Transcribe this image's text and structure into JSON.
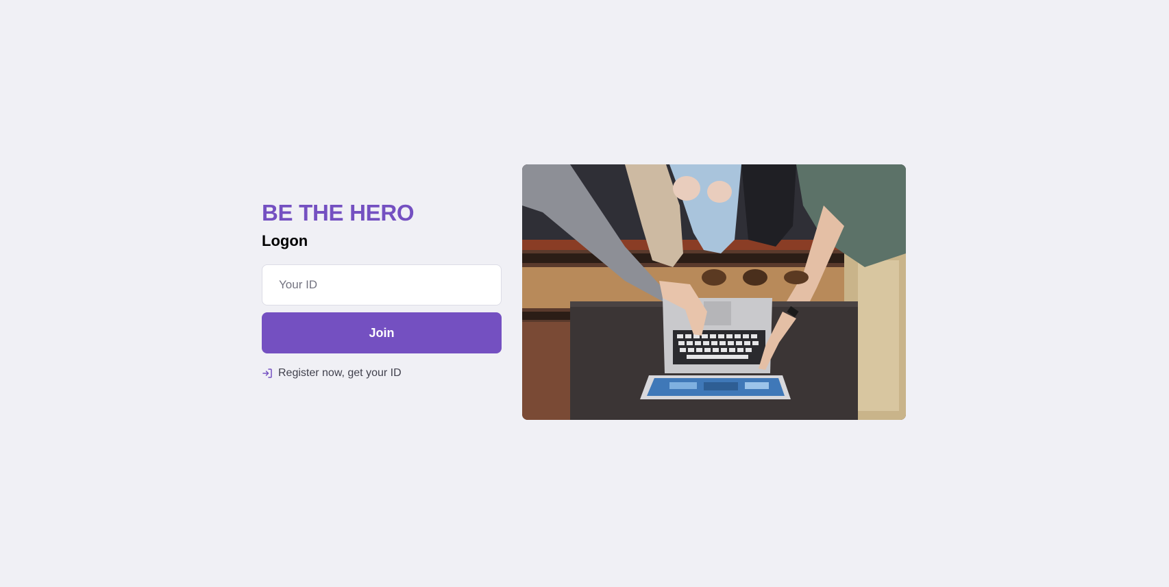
{
  "brand": {
    "title": "BE THE HERO",
    "color": "#7450c1"
  },
  "logon": {
    "heading": "Logon",
    "id_input": {
      "placeholder": "Your ID",
      "value": ""
    },
    "join_label": "Join",
    "register_link": {
      "icon": "log-in-icon",
      "label": "Register now, get your ID"
    }
  },
  "hero_image": {
    "description_icon": "people-using-laptop-photo"
  },
  "colors": {
    "background": "#f0f0f5",
    "accent": "#7450c1",
    "text": "#41414d"
  }
}
